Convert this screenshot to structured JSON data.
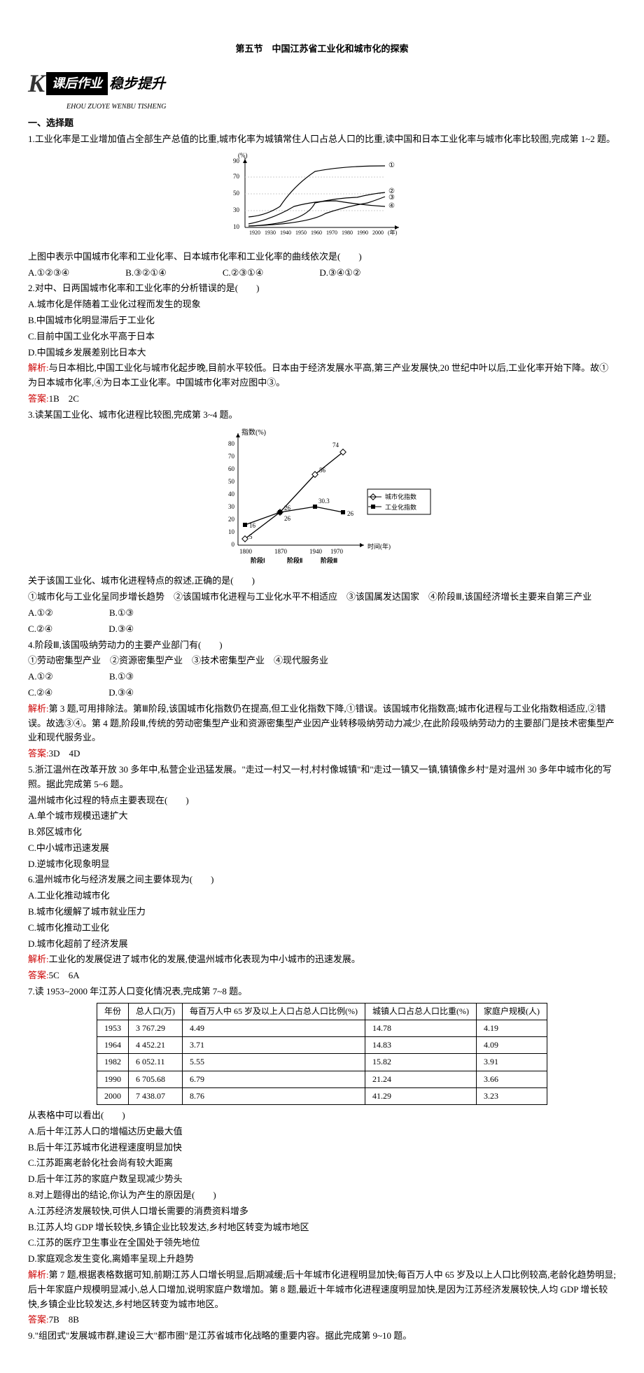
{
  "title": "第五节　中国江苏省工业化和城市化的探索",
  "banner": {
    "k": "K",
    "box": "课后作业",
    "bold": "稳步提升",
    "pinyin": "EHOU ZUOYE WENBU TISHENG"
  },
  "section1": "一、选择题",
  "q1": "1.工业化率是工业增加值占全部生产总值的比重,城市化率为城镇常住人口占总人口的比重,读中国和日本工业化率与城市化率比较图,完成第 1~2 题。",
  "chart1": {
    "ylabel": "(%)",
    "xticks": [
      "1920",
      "1930",
      "1940",
      "1950",
      "1960",
      "1970",
      "1980",
      "1990",
      "2000"
    ],
    "xlabel": "(年)",
    "yticks": [
      "10",
      "30",
      "50",
      "70",
      "90"
    ],
    "series_labels": [
      "①",
      "②",
      "③",
      "④"
    ]
  },
  "q1b": "上图中表示中国城市化率和工业化率、日本城市化率和工业化率的曲线依次是(　　)",
  "q1opts": [
    "A.①②③④",
    "B.③②①④",
    "C.②③①④",
    "D.③④①②"
  ],
  "q2": "2.对中、日两国城市化率和工业化率的分析错误的是(　　)",
  "q2opts": [
    "A.城市化是伴随着工业化过程而发生的现象",
    "B.中国城市化明显滞后于工业化",
    "C.目前中国工业化水平高于日本",
    "D.中国城乡发展差别比日本大"
  ],
  "a12_label": "解析:",
  "a12": "与日本相比,中国工业化与城市化起步晚,目前水平较低。日本由于经济发展水平高,第三产业发展快,20 世纪中叶以后,工业化率开始下降。故①为日本城市化率,④为日本工业化率。中国城市化率对应图中③。",
  "ans12_label": "答案:",
  "ans12": "1B　2C",
  "q3": "3.读某国工业化、城市化进程比较图,完成第 3~4 题。",
  "chart2": {
    "ylabel": "指数(%)",
    "yticks": [
      "0",
      "10",
      "20",
      "30",
      "40",
      "50",
      "60",
      "70",
      "80"
    ],
    "xticks": [
      "1800",
      "1870",
      "1940",
      "1970"
    ],
    "xlabel": "时间(年)",
    "stages": [
      "阶段Ⅰ",
      "阶段Ⅱ",
      "阶段Ⅲ"
    ],
    "legend": [
      "城市化指数",
      "工业化指数"
    ],
    "points": {
      "urban": [
        5,
        26,
        56,
        74
      ],
      "ind": [
        16,
        26,
        30.3,
        26
      ]
    }
  },
  "q3b": "关于该国工业化、城市化进程特点的叙述,正确的是(　　)",
  "q3c": "①城市化与工业化呈同步增长趋势　②该国城市化进程与工业化水平不相适应　③该国属发达国家　④阶段Ⅲ,该国经济增长主要来自第三产业",
  "q3opts": [
    "A.①②",
    "B.①③",
    "C.②④",
    "D.③④"
  ],
  "q4": "4.阶段Ⅲ,该国吸纳劳动力的主要产业部门有(　　)",
  "q4b": "①劳动密集型产业　②资源密集型产业　③技术密集型产业　④现代服务业",
  "q4opts": [
    "A.①②",
    "B.①③",
    "C.②④",
    "D.③④"
  ],
  "a34_label": "解析:",
  "a34": "第 3 题,可用排除法。第Ⅲ阶段,该国城市化指数仍在提高,但工业化指数下降,①错误。该国城市化指数高;城市化进程与工业化指数相适应,②错误。故选③④。第 4 题,阶段Ⅲ,传统的劳动密集型产业和资源密集型产业因产业转移吸纳劳动力减少,在此阶段吸纳劳动力的主要部门是技术密集型产业和现代服务业。",
  "ans34_label": "答案:",
  "ans34": "3D　4D",
  "q5": "5.浙江温州在改革开放 30 多年中,私营企业迅猛发展。\"走过一村又一村,村村像城镇\"和\"走过一镇又一镇,镇镇像乡村\"是对温州 30 多年中城市化的写照。据此完成第 5~6 题。",
  "q5b": "温州城市化过程的特点主要表现在(　　)",
  "q5opts": [
    "A.单个城市规模迅速扩大",
    "B.郊区城市化",
    "C.中小城市迅速发展",
    "D.逆城市化现象明显"
  ],
  "q6": "6.温州城市化与经济发展之间主要体现为(　　)",
  "q6opts": [
    "A.工业化推动城市化",
    "B.城市化缓解了城市就业压力",
    "C.城市化推动工业化",
    "D.城市化超前了经济发展"
  ],
  "a56_label": "解析:",
  "a56": "工业化的发展促进了城市化的发展,使温州城市化表现为中小城市的迅速发展。",
  "ans56_label": "答案:",
  "ans56": "5C　6A",
  "q7": "7.读 1953~2000 年江苏人口变化情况表,完成第 7~8 题。",
  "table": {
    "headers": [
      "年份",
      "总人口(万)",
      "每百万人中 65 岁及以上人口占总人口比例(%)",
      "城镇人口占总人口比重(%)",
      "家庭户规模(人)"
    ],
    "rows": [
      [
        "1953",
        "3 767.29",
        "4.49",
        "14.78",
        "4.19"
      ],
      [
        "1964",
        "4 452.21",
        "3.71",
        "14.83",
        "4.09"
      ],
      [
        "1982",
        "6 052.11",
        "5.55",
        "15.82",
        "3.91"
      ],
      [
        "1990",
        "6 705.68",
        "6.79",
        "21.24",
        "3.66"
      ],
      [
        "2000",
        "7 438.07",
        "8.76",
        "41.29",
        "3.23"
      ]
    ]
  },
  "q7b": "从表格中可以看出(　　)",
  "q7opts": [
    "A.后十年江苏人口的增幅达历史最大值",
    "B.后十年江苏城市化进程速度明显加快",
    "C.江苏距离老龄化社会尚有较大距离",
    "D.后十年江苏的家庭户数呈现减少势头"
  ],
  "q8": "8.对上题得出的结论,你认为产生的原因是(　　)",
  "q8opts": [
    "A.江苏经济发展较快,可供人口增长需要的消费资料增多",
    "B.江苏人均 GDP 增长较快,乡镇企业比较发达,乡村地区转变为城市地区",
    "C.江苏的医疗卫生事业在全国处于领先地位",
    "D.家庭观念发生变化,离婚率呈现上升趋势"
  ],
  "a78_label": "解析:",
  "a78": "第 7 题,根据表格数据可知,前期江苏人口增长明显,后期减缓;后十年城市化进程明显加快;每百万人中 65 岁及以上人口比例较高,老龄化趋势明显;后十年家庭户规模明显减小,总人口增加,说明家庭户数增加。第 8 题,最近十年城市化进程速度明显加快,是因为江苏经济发展较快,人均 GDP 增长较快,乡镇企业比较发达,乡村地区转变为城市地区。",
  "ans78_label": "答案:",
  "ans78": "7B　8B",
  "q9": "9.\"组团式\"发展城市群,建设三大\"都市圈\"是江苏省城市化战略的重要内容。据此完成第 9~10 题。"
}
